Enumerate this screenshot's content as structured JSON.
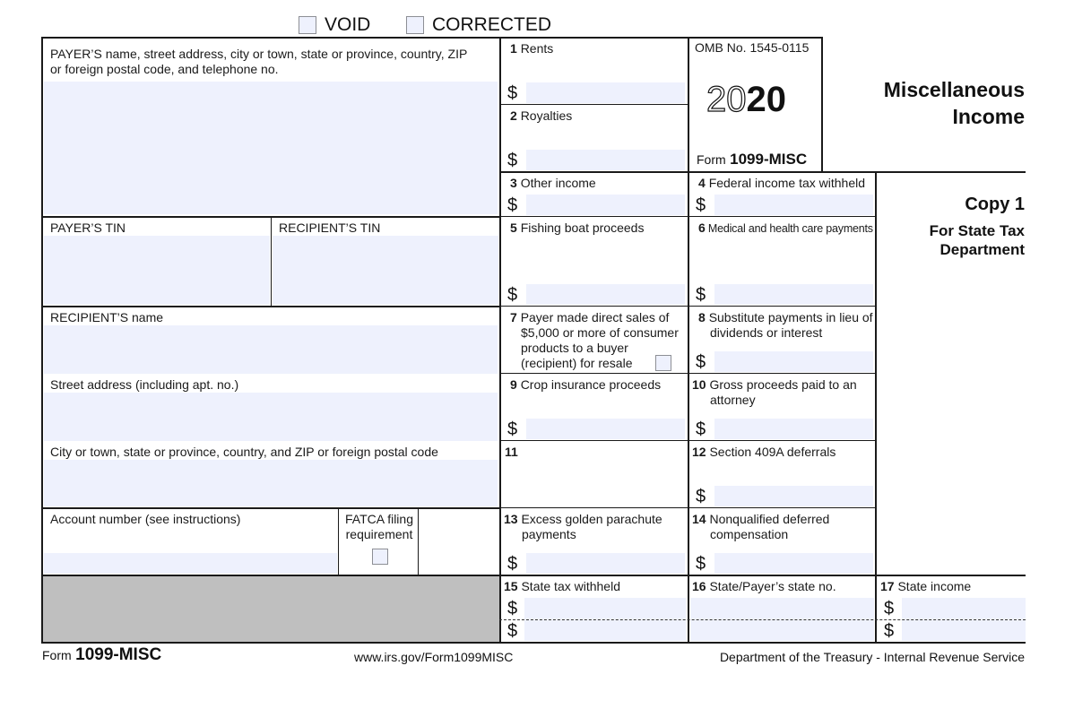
{
  "header": {
    "void_label": "VOID",
    "corrected_label": "CORRECTED"
  },
  "payer": {
    "name_label_line1": "PAYER’S name, street address, city or town, state or province, country, ZIP",
    "name_label_line2": "or foreign postal code, and telephone no.",
    "tin_label": "PAYER’S TIN"
  },
  "recipient": {
    "tin_label": "RECIPIENT’S TIN",
    "name_label": "RECIPIENT’S name",
    "street_label": "Street address (including apt. no.)",
    "city_label": "City or town, state or province, country, and ZIP or foreign postal code",
    "account_label": "Account number (see instructions)",
    "fatca_line1": "FATCA filing",
    "fatca_line2": "requirement"
  },
  "form_info": {
    "omb": "OMB No. 1545-0115",
    "year_outline": "20",
    "year_bold": "20",
    "form_prefix": "Form",
    "form_name": "1099-MISC",
    "title_line1": "Miscellaneous",
    "title_line2": "Income",
    "copy_title": "Copy 1",
    "copy_sub_line1": "For State Tax",
    "copy_sub_line2": "Department"
  },
  "boxes": {
    "b1": {
      "num": "1",
      "label": "Rents"
    },
    "b2": {
      "num": "2",
      "label": "Royalties"
    },
    "b3": {
      "num": "3",
      "label": "Other income"
    },
    "b4": {
      "num": "4",
      "label": "Federal income tax withheld"
    },
    "b5": {
      "num": "5",
      "label": "Fishing boat proceeds"
    },
    "b6": {
      "num": "6",
      "label": "Medical and health care payments"
    },
    "b7": {
      "num": "7",
      "line1": "Payer made direct sales of",
      "line2": "$5,000 or more of consumer",
      "line3": "products to a buyer",
      "line4": "(recipient) for resale"
    },
    "b8": {
      "num": "8",
      "line1": "Substitute payments in lieu of",
      "line2": "dividends or interest"
    },
    "b9": {
      "num": "9",
      "label": "Crop insurance proceeds"
    },
    "b10": {
      "num": "10",
      "line1": "Gross proceeds paid to an",
      "line2": "attorney"
    },
    "b11": {
      "num": "11",
      "label": ""
    },
    "b12": {
      "num": "12",
      "label": "Section 409A deferrals"
    },
    "b13": {
      "num": "13",
      "line1": "Excess golden parachute",
      "line2": "payments"
    },
    "b14": {
      "num": "14",
      "line1": "Nonqualified deferred",
      "line2": "compensation"
    },
    "b15": {
      "num": "15",
      "label": "State tax withheld"
    },
    "b16": {
      "num": "16",
      "label": "State/Payer’s state no."
    },
    "b17": {
      "num": "17",
      "label": "State income"
    }
  },
  "currency_symbol": "$",
  "footer": {
    "form_prefix": "Form",
    "form_name": "1099-MISC",
    "url": "www.irs.gov/Form1099MISC",
    "agency": "Department of the Treasury - Internal Revenue Service"
  }
}
